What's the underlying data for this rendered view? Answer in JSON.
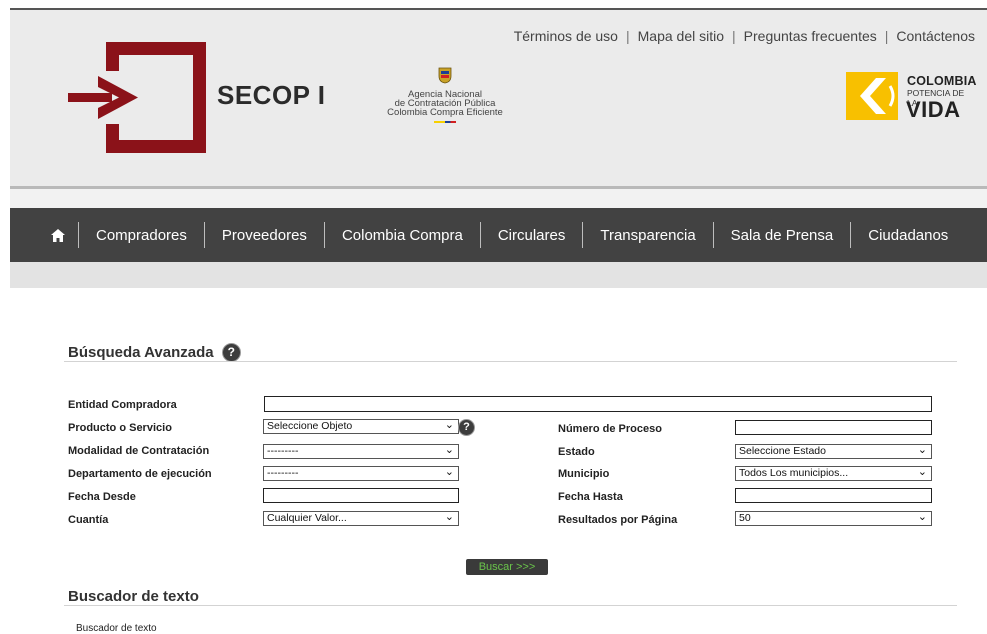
{
  "header": {
    "top_links": [
      "Términos de uso",
      "Mapa del sitio",
      "Preguntas frecuentes",
      "Contáctenos"
    ],
    "brand": "SECOP I",
    "agency_lines": [
      "Agencia Nacional",
      "de Contratación Pública",
      "Colombia Compra Eficiente"
    ],
    "gov_logo": {
      "line1": "COLOMBIA",
      "line2": "POTENCIA DE LA",
      "line3": "VIDA"
    },
    "brand_color": "#8b1219",
    "logo_yellow": "#f8c000"
  },
  "nav": {
    "home_icon": "home-icon",
    "items": [
      "Compradores",
      "Proveedores",
      "Colombia Compra",
      "Circulares",
      "Transparencia",
      "Sala de Prensa",
      "Ciudadanos"
    ]
  },
  "search": {
    "title": "Búsqueda Avanzada",
    "help_icon": "help-icon",
    "fields": {
      "entidad": {
        "label": "Entidad Compradora",
        "value": ""
      },
      "producto": {
        "label": "Producto o Servicio",
        "selected": "Seleccione Objeto"
      },
      "modalidad": {
        "label": "Modalidad de Contratación",
        "selected": "---------"
      },
      "departamento": {
        "label": "Departamento de ejecución",
        "selected": "---------"
      },
      "fecha_desde": {
        "label": "Fecha Desde",
        "value": ""
      },
      "cuantia": {
        "label": "Cuantía",
        "selected": "Cualquier Valor..."
      },
      "numero_proceso": {
        "label": "Número de Proceso",
        "value": ""
      },
      "estado": {
        "label": "Estado",
        "selected": "Seleccione Estado"
      },
      "municipio": {
        "label": "Municipio",
        "selected": "Todos Los municipios..."
      },
      "fecha_hasta": {
        "label": "Fecha Hasta",
        "value": ""
      },
      "resultados": {
        "label": "Resultados por Página",
        "selected": "50"
      }
    },
    "submit_label": "Buscar >>>"
  },
  "text_search": {
    "title": "Buscador de texto",
    "label": "Buscador de texto"
  }
}
